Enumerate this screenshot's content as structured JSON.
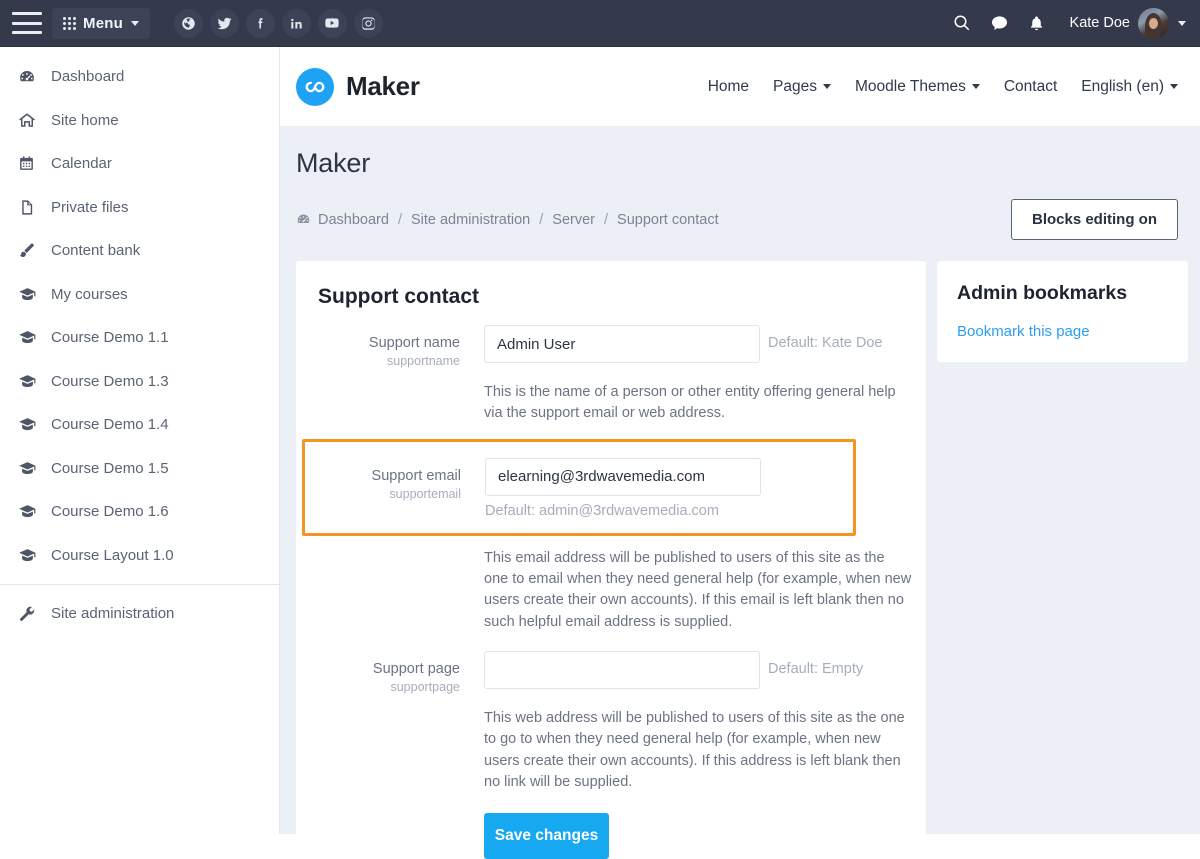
{
  "topbar": {
    "menu_label": "Menu",
    "menu_icon": "grid-icon",
    "hamburger_icon": "hamburger-icon",
    "socials": [
      {
        "name": "globe-icon",
        "label": "Website"
      },
      {
        "name": "twitter-icon",
        "label": "Twitter"
      },
      {
        "name": "facebook-icon",
        "label": "Facebook"
      },
      {
        "name": "linkedin-icon",
        "label": "LinkedIn"
      },
      {
        "name": "youtube-icon",
        "label": "YouTube"
      },
      {
        "name": "instagram-icon",
        "label": "Instagram"
      }
    ],
    "search_icon": "search-icon",
    "messages_icon": "chat-bubble-icon",
    "notifications_icon": "bell-icon",
    "user_name": "Kate Doe",
    "avatar": "user-avatar",
    "background_color": "#343a4c"
  },
  "sidebar": {
    "items": [
      {
        "label": "Dashboard",
        "icon": "gauge-icon"
      },
      {
        "label": "Site home",
        "icon": "home-icon"
      },
      {
        "label": "Calendar",
        "icon": "calendar-icon"
      },
      {
        "label": "Private files",
        "icon": "file-icon"
      },
      {
        "label": "Content bank",
        "icon": "brush-icon"
      },
      {
        "label": "My courses",
        "icon": "graduation-cap-icon"
      },
      {
        "label": "Course Demo 1.1",
        "icon": "graduation-cap-icon"
      },
      {
        "label": "Course Demo 1.3",
        "icon": "graduation-cap-icon"
      },
      {
        "label": "Course Demo 1.4",
        "icon": "graduation-cap-icon"
      },
      {
        "label": "Course Demo 1.5",
        "icon": "graduation-cap-icon"
      },
      {
        "label": "Course Demo 1.6",
        "icon": "graduation-cap-icon"
      },
      {
        "label": "Course Layout 1.0",
        "icon": "graduation-cap-icon"
      }
    ],
    "admin_item": {
      "label": "Site administration",
      "icon": "wrench-icon"
    }
  },
  "site_header": {
    "brand_name": "Maker",
    "brand_logo_icon": "infinity-loop-icon",
    "brand_color": "#1ea2f3",
    "nav": [
      {
        "label": "Home",
        "has_caret": false
      },
      {
        "label": "Pages",
        "has_caret": true
      },
      {
        "label": "Moodle Themes",
        "has_caret": true
      },
      {
        "label": "Contact",
        "has_caret": false
      },
      {
        "label": "English (en)",
        "has_caret": true
      }
    ]
  },
  "page": {
    "title": "Maker",
    "breadcrumb": {
      "icon": "gauge-icon",
      "items": [
        "Dashboard",
        "Site administration",
        "Server",
        "Support contact"
      ],
      "separator": "/"
    },
    "blocks_button": "Blocks editing on"
  },
  "main_card": {
    "title": "Support contact",
    "highlight_color": "#f59421",
    "fields": [
      {
        "label": "Support name",
        "id": "supportname",
        "value": "Admin User",
        "placeholder": "",
        "default_text": "Default: Kate Doe",
        "default_position": "right",
        "description": "This is the name of a person or other entity offering general help via the support email or web address.",
        "highlighted": false
      },
      {
        "label": "Support email",
        "id": "supportemail",
        "value": "elearning@3rdwavemedia.com",
        "placeholder": "",
        "default_text": "Default: admin@3rdwavemedia.com",
        "default_position": "below",
        "description": "This email address will be published to users of this site as the one to email when they need general help (for example, when new users create their own accounts). If this email is left blank then no such helpful email address is supplied.",
        "highlighted": true
      },
      {
        "label": "Support page",
        "id": "supportpage",
        "value": "",
        "placeholder": "",
        "default_text": "Default: Empty",
        "default_position": "right",
        "description": "This web address will be published to users of this site as the one to go to when they need general help (for example, when new users create their own accounts). If this address is left blank then no link will be supplied.",
        "highlighted": false
      }
    ],
    "save_button": "Save changes",
    "save_button_color": "#17a8f2"
  },
  "side_card": {
    "title": "Admin bookmarks",
    "link": "Bookmark this page",
    "link_color": "#2c9ef4"
  }
}
